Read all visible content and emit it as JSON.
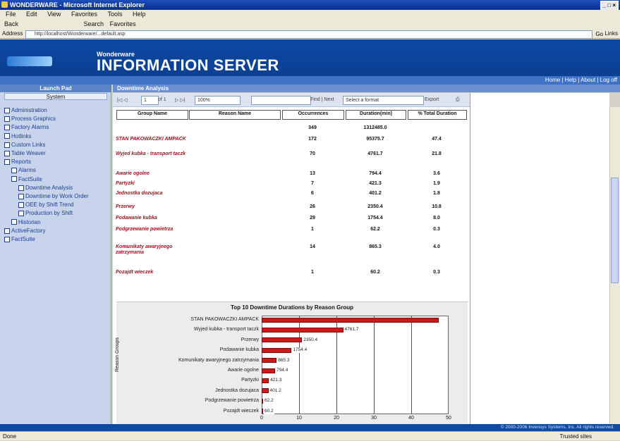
{
  "browser": {
    "title": "WONDERWARE - Microsoft Internet Explorer",
    "menu": [
      "File",
      "Edit",
      "View",
      "Favorites",
      "Tools",
      "Help"
    ],
    "toolbar": [
      "Back",
      "Search",
      "Favorites"
    ],
    "address_label": "Address",
    "address": "http://localhost/Wonderware/...default.asp",
    "go_label": "Go",
    "links_label": "Links",
    "status_left": "Done",
    "status_right": "Trusted sites"
  },
  "banner": {
    "brand_small": "Wonderware",
    "brand_big": "INFORMATION SERVER",
    "nav_links": "Home | Help | About | Log off"
  },
  "left": {
    "header": "Launch Pad",
    "sub": "System",
    "tree": [
      {
        "label": "Administration",
        "indent": 0
      },
      {
        "label": "Process Graphics",
        "indent": 0
      },
      {
        "label": "Factory Alarms",
        "indent": 0
      },
      {
        "label": "Hotlinks",
        "indent": 0
      },
      {
        "label": "Custom Links",
        "indent": 0
      },
      {
        "label": "Table Weaver",
        "indent": 0
      },
      {
        "label": "Reports",
        "indent": 0
      },
      {
        "label": "Alarms",
        "indent": 1
      },
      {
        "label": "FactSuite",
        "indent": 1
      },
      {
        "label": "Downtime Analysis",
        "indent": 2
      },
      {
        "label": "Downtime by Work Order",
        "indent": 2
      },
      {
        "label": "OEE by Shift Trend",
        "indent": 2
      },
      {
        "label": "Production by Shift",
        "indent": 2
      },
      {
        "label": "Historian",
        "indent": 1
      },
      {
        "label": "ActiveFactory",
        "indent": 0
      },
      {
        "label": "FactSuite",
        "indent": 0
      }
    ]
  },
  "content": {
    "header": "Downtime Analysis",
    "page_of": "of 1",
    "zoom": "100%",
    "find_next": "Find | Next",
    "format_select": "Select a format",
    "export_label": "Export"
  },
  "table": {
    "headers": [
      "Group Name",
      "Reason Name",
      "Occurrences",
      "Duration(min)",
      "% Total Duration"
    ],
    "total": {
      "occurrences": "349",
      "duration": "1312485.0"
    },
    "rows": [
      {
        "name": "STAN PAKOWACZKI AMPACK",
        "occ": "172",
        "dur": "95375.7",
        "pct": "47.4"
      },
      {
        "name": "Wyjed kubka - transport taczk",
        "occ": "70",
        "dur": "4761.7",
        "pct": "21.8"
      },
      {
        "name": "Awarie ogolne",
        "occ": "13",
        "dur": "794.4",
        "pct": "3.6"
      },
      {
        "name": "Partyzki",
        "occ": "7",
        "dur": "421.3",
        "pct": "1.9"
      },
      {
        "name": "Jednostka dozujaca",
        "occ": "6",
        "dur": "401.2",
        "pct": "1.8"
      },
      {
        "name": "Przerwy",
        "occ": "26",
        "dur": "2350.4",
        "pct": "10.8"
      },
      {
        "name": "Podawanie kubka",
        "occ": "29",
        "dur": "1754.4",
        "pct": "8.0"
      },
      {
        "name": "Podgrzewanie powietrza",
        "occ": "1",
        "dur": "62.2",
        "pct": "0.3"
      },
      {
        "name": "Komunikaty awaryjnego zatrzymania",
        "occ": "14",
        "dur": "865.3",
        "pct": "4.0"
      },
      {
        "name": "Pozajdt wieczek",
        "occ": "1",
        "dur": "60.2",
        "pct": "0.3"
      }
    ]
  },
  "chart_data": {
    "type": "bar",
    "orientation": "horizontal",
    "title": "Top 10 Downtime Durations by Reason Group",
    "ylabel": "Reason Groups",
    "xlabel": "",
    "xlim": [
      0,
      50
    ],
    "xticks": [
      "0",
      "10",
      "20",
      "30",
      "40",
      "50"
    ],
    "categories": [
      "STAN PAKOWACZKI AMPACK",
      "Wyjed kubka - transport taczk",
      "Przerwy",
      "Podawanie kubka",
      "Komunikaty awaryjnego zatrzymania",
      "Awarie ogolne",
      "Partyzki",
      "Jednostka dozujaca",
      "Podgrzewanie powietrza",
      "Pozajdt wieczek"
    ],
    "values": [
      47.4,
      21.8,
      10.8,
      8.0,
      4.0,
      3.6,
      1.9,
      1.8,
      0.3,
      0.3
    ],
    "data_labels": [
      "",
      "4761.7",
      "2350.4",
      "1754.4",
      "865.3",
      "794.4",
      "421.3",
      "401.2",
      "62.2",
      "60.2"
    ],
    "bar_color": "#cc1a1a"
  },
  "footer": "© 2000-2006 Invensys Systems, Inc. All rights reserved."
}
